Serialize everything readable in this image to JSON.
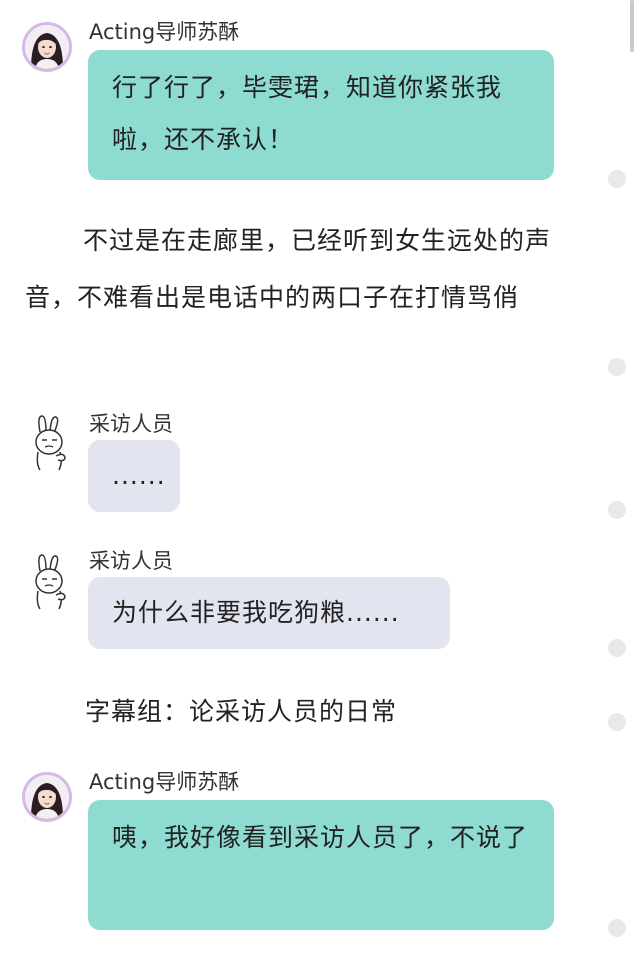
{
  "thread": {
    "messages": [
      {
        "sender": "Acting导师苏酥",
        "text": "行了行了，毕雯珺，知道你紧张我啦，还不承认！"
      },
      {
        "narration": "不过是在走廊里，已经听到女生远处的声音，不难看出是电话中的两口子在打情骂俏"
      },
      {
        "sender": "采访人员",
        "text": "......"
      },
      {
        "sender": "采访人员",
        "text": "为什么非要我吃狗粮......"
      },
      {
        "narration": "字幕组：论采访人员的日常"
      },
      {
        "sender": "Acting导师苏酥",
        "text": "咦，我好像看到采访人员了，不说了"
      }
    ]
  },
  "colors": {
    "teal_bubble": "#8edbd2",
    "gray_bubble": "#e2e5f0",
    "avatar_ring": "#d7b8e6"
  },
  "icons": {
    "girl_avatar": "user-avatar-photo-icon",
    "bunny_avatar": "bunny-sticker-avatar-icon"
  }
}
